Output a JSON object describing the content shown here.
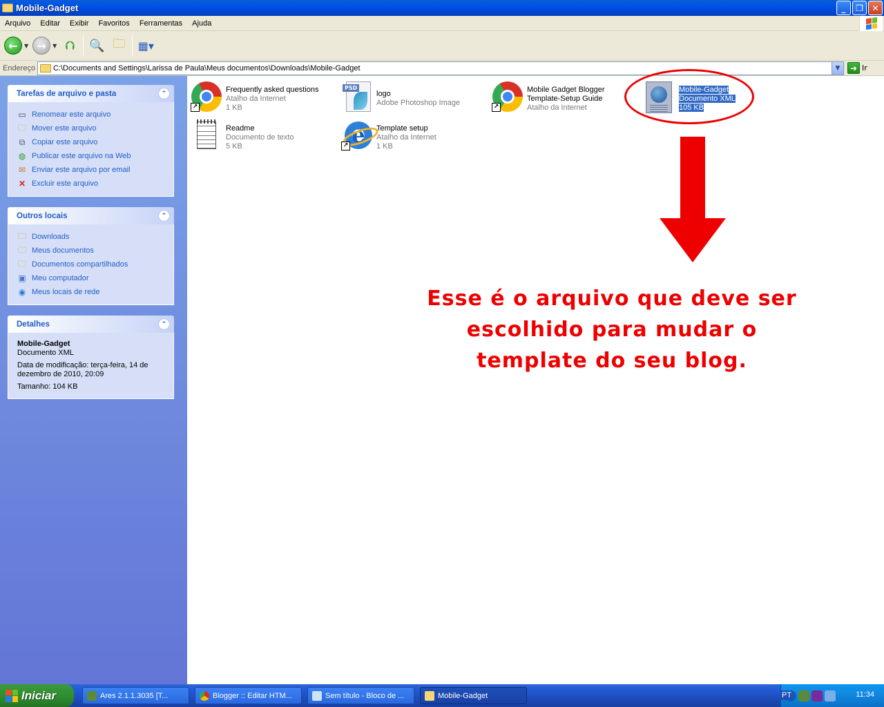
{
  "window": {
    "title": "Mobile-Gadget"
  },
  "menu": [
    "Arquivo",
    "Editar",
    "Exibir",
    "Favoritos",
    "Ferramentas",
    "Ajuda"
  ],
  "toolbar": {
    "back_icon": "back-arrow-icon",
    "forward_icon": "forward-arrow-icon",
    "up_icon": "folder-up-icon",
    "search_icon": "search-icon",
    "folders_icon": "folders-icon",
    "views_icon": "views-icon"
  },
  "address": {
    "label": "Endereço",
    "path": "C:\\Documents and Settings\\Larissa de Paula\\Meus documentos\\Downloads\\Mobile-Gadget",
    "go_label": "Ir"
  },
  "tasks_panel": {
    "title": "Tarefas de arquivo e pasta",
    "items": [
      "Renomear este arquivo",
      "Mover este arquivo",
      "Copiar este arquivo",
      "Publicar este arquivo na Web",
      "Enviar este arquivo por email",
      "Excluir este arquivo"
    ]
  },
  "places_panel": {
    "title": "Outros locais",
    "items": [
      "Downloads",
      "Meus documentos",
      "Documentos compartilhados",
      "Meu computador",
      "Meus locais de rede"
    ]
  },
  "details_panel": {
    "title": "Detalhes",
    "name": "Mobile-Gadget",
    "type": "Documento XML",
    "modified": "Data de modificação: terça-feira, 14 de dezembro de 2010, 20:09",
    "size": "Tamanho: 104 KB"
  },
  "files": [
    {
      "name": "Frequently asked questions",
      "type": "Atalho da Internet",
      "size": "1 KB"
    },
    {
      "name": "logo",
      "type": "Adobe Photoshop Image",
      "size": ""
    },
    {
      "name": "Mobile Gadget Blogger",
      "name2": "Template-Setup Guide",
      "type": "Atalho da Internet",
      "size": ""
    },
    {
      "name": "Mobile-Gadget",
      "type": "Documento XML",
      "size": "105 KB"
    },
    {
      "name": "Readme",
      "type": "Documento de texto",
      "size": "5 KB"
    },
    {
      "name": "Template setup",
      "type": "Atalho da Internet",
      "size": "1 KB"
    }
  ],
  "psd_badge": "PSD",
  "annotation": {
    "line1": "Esse é o arquivo que deve ser",
    "line2": "escolhido para mudar o",
    "line3": "template do seu blog."
  },
  "taskbar": {
    "start": "Iniciar",
    "buttons": [
      "Ares 2.1.1.3035   [T...",
      "Blogger :: Editar HTM...",
      "Sem título - Bloco de ...",
      "Mobile-Gadget"
    ],
    "lang": "PT",
    "clock": "11:34"
  }
}
